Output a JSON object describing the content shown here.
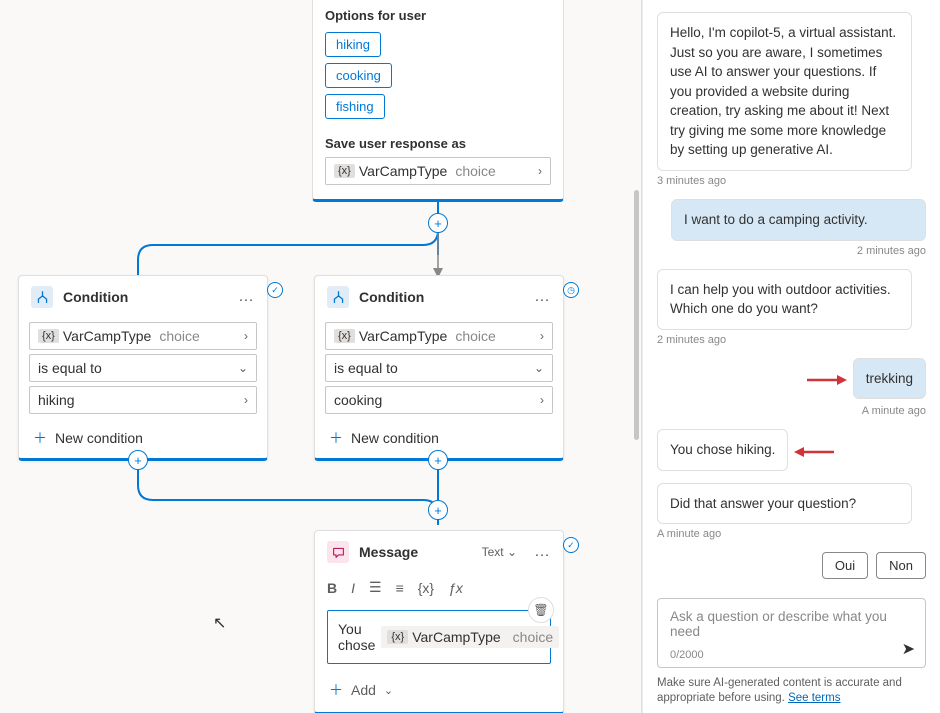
{
  "options_node": {
    "title": "Options for user",
    "options": [
      "hiking",
      "cooking",
      "fishing"
    ],
    "save_label": "Save user response as",
    "var_name": "VarCampType",
    "var_type": "choice"
  },
  "condition1": {
    "title": "Condition",
    "var_name": "VarCampType",
    "var_type": "choice",
    "operator": "is equal to",
    "value": "hiking",
    "add": "New condition"
  },
  "condition2": {
    "title": "Condition",
    "var_name": "VarCampType",
    "var_type": "choice",
    "operator": "is equal to",
    "value": "cooking",
    "add": "New condition"
  },
  "message_node": {
    "title": "Message",
    "type_label": "Text",
    "prefix": "You chose",
    "var_name": "VarCampType",
    "var_type": "choice",
    "add": "Add"
  },
  "chat": {
    "m1": "Hello, I'm copilot-5, a virtual assistant. Just so you are aware, I sometimes use AI to answer your questions. If you provided a website during creation, try asking me about it! Next try giving me some more knowledge by setting up generative AI.",
    "t1": "3 minutes ago",
    "u1": "I want to do a camping activity.",
    "t2": "2 minutes ago",
    "m2": "I can help you with outdoor activities. Which one do you want?",
    "t3": "2 minutes ago",
    "u2": "trekking",
    "t4": "A minute ago",
    "m3": "You chose hiking.",
    "m4": "Did that answer your question?",
    "t5": "A minute ago",
    "quick": {
      "yes": "Oui",
      "no": "Non"
    },
    "placeholder": "Ask a question or describe what you need",
    "count": "0/2000",
    "disclaimer_a": "Make sure AI-generated content is accurate and appropriate before using. ",
    "disclaimer_link": "See terms"
  }
}
